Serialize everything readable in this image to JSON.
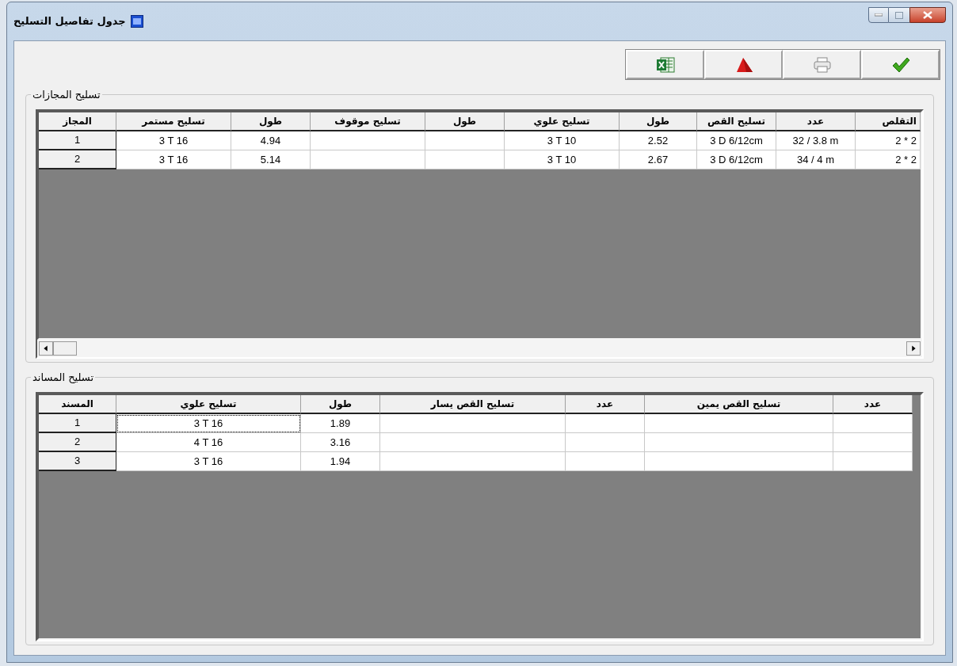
{
  "window": {
    "title": "جدول تفاصيل التسليح"
  },
  "toolbar": [
    {
      "kind": "excel"
    },
    {
      "kind": "pdf"
    },
    {
      "kind": "print"
    },
    {
      "kind": "ok"
    }
  ],
  "spans": {
    "title": "تسليح المجازات",
    "columns": [
      "التقلص",
      "عدد",
      "تسليح القص",
      "طول",
      "تسليح علوي",
      "طول",
      "تسليح موقوف",
      "طول",
      "تسليح مستمر",
      "المجاز"
    ],
    "rows": [
      {
        "cells": [
          {
            "text": "2 * 2",
            "focused": false
          },
          {
            "text": "32 / 3.8 m",
            "focused": false
          },
          {
            "text": "3 D 6/12cm",
            "focused": false
          },
          {
            "text": "2.52",
            "focused": false
          },
          {
            "text": "3 T 10",
            "focused": false
          },
          {
            "focused": false
          },
          {
            "focused": false
          },
          {
            "text": "4.94",
            "focused": false
          },
          {
            "text": "3 T 16",
            "focused": false
          },
          {
            "text": "1",
            "focused": false
          }
        ]
      },
      {
        "cells": [
          {
            "text": "2 * 2",
            "focused": false
          },
          {
            "text": "34 / 4 m",
            "focused": false
          },
          {
            "text": "3 D 6/12cm",
            "focused": false
          },
          {
            "text": "2.67",
            "focused": false
          },
          {
            "text": "3 T 10",
            "focused": false
          },
          {
            "focused": false
          },
          {
            "focused": false
          },
          {
            "text": "5.14",
            "focused": false
          },
          {
            "text": "3 T 16",
            "focused": false
          },
          {
            "text": "2",
            "focused": false
          }
        ]
      }
    ]
  },
  "supports": {
    "title": "تسليح المساند",
    "columns": [
      "عدد",
      "تسليح القص يمين",
      "عدد",
      "تسليح القص يسار",
      "طول",
      "تسليح علوي",
      "المسند"
    ],
    "rows": [
      {
        "cells": [
          {
            "focused": false
          },
          {
            "focused": false
          },
          {
            "focused": false
          },
          {
            "focused": false
          },
          {
            "text": "1.89",
            "focused": false
          },
          {
            "text": "3 T 16",
            "focused": true
          },
          {
            "text": "1",
            "focused": false
          }
        ]
      },
      {
        "cells": [
          {
            "focused": false
          },
          {
            "focused": false
          },
          {
            "focused": false
          },
          {
            "focused": false
          },
          {
            "text": "3.16",
            "focused": false
          },
          {
            "text": "4 T 16",
            "focused": false
          },
          {
            "text": "2",
            "focused": false
          }
        ]
      },
      {
        "cells": [
          {
            "focused": false
          },
          {
            "focused": false
          },
          {
            "focused": false
          },
          {
            "focused": false
          },
          {
            "text": "1.94",
            "focused": false
          },
          {
            "text": "3 T 16",
            "focused": false
          },
          {
            "text": "3",
            "focused": false
          }
        ]
      }
    ]
  }
}
